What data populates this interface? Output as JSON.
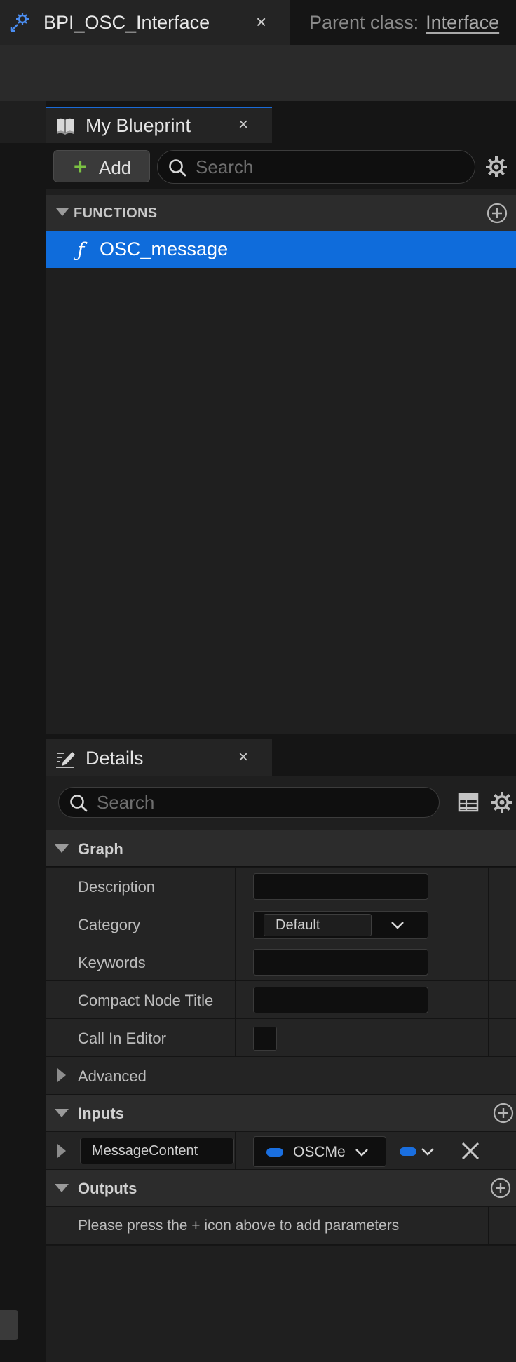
{
  "document_tab": {
    "title": "BPI_OSC_Interface",
    "close": "×",
    "icon": "blueprint-interface-icon"
  },
  "parent_class": {
    "label": "Parent class:",
    "value": "Interface"
  },
  "my_blueprint": {
    "tab_label": "My Blueprint",
    "close": "×",
    "icon": "book-icon",
    "add_label": "Add",
    "search_placeholder": "Search",
    "functions_header": "FUNCTIONS",
    "functions": [
      {
        "icon_glyph": "ƒ",
        "name": "OSC_message",
        "selected": true
      }
    ]
  },
  "details": {
    "tab_label": "Details",
    "close": "×",
    "icon": "pencil-icon",
    "search_placeholder": "Search",
    "graph_header": "Graph",
    "rows": {
      "description": "Description",
      "category": "Category",
      "category_value": "Default",
      "keywords": "Keywords",
      "compact_node_title": "Compact Node Title",
      "call_in_editor": "Call In Editor"
    },
    "advanced": "Advanced",
    "inputs_header": "Inputs",
    "inputs": [
      {
        "name": "MessageContent",
        "type": "OSCMessage",
        "type_display": "OSCMes"
      }
    ],
    "outputs_header": "Outputs",
    "outputs_empty": "Please press the + icon above to add parameters"
  },
  "colors": {
    "selection": "#0f6cdb",
    "add_plus": "#7bc143",
    "pin_struct": "#1a6fe0"
  }
}
